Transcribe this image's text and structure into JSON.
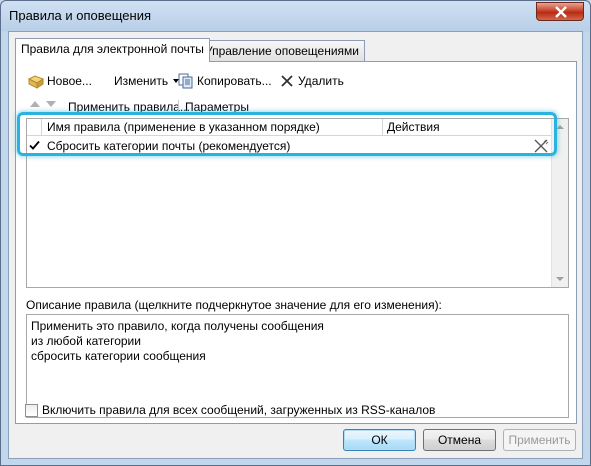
{
  "window": {
    "title": "Правила и оповещения"
  },
  "tabs": [
    {
      "label": "Правила для электронной почты"
    },
    {
      "label": "Управление оповещениями"
    }
  ],
  "toolbar": {
    "new_label": "Новое...",
    "change_label": "Изменить",
    "copy_label": "Копировать...",
    "delete_label": "Удалить"
  },
  "subbar": {
    "apply_label": "Применить правила...",
    "options_label": "Параметры"
  },
  "rules_list": {
    "columns": [
      "Имя правила (применение в указанном порядке)",
      "Действия"
    ],
    "rows": [
      {
        "name": "Сбросить категории почты (рекомендуется)",
        "checked": true
      }
    ]
  },
  "description": {
    "label": "Описание правила (щелкните подчеркнутое значение для его изменения):",
    "lines": [
      "Применить это правило, когда получены сообщения",
      "из любой категории",
      "сбросить категории сообщения"
    ]
  },
  "rss": {
    "label": "Включить правила для всех сообщений, загруженных из RSS-каналов",
    "checked": false
  },
  "buttons": {
    "ok": "ОК",
    "cancel": "Отмена",
    "apply": "Применить"
  },
  "colors": {
    "highlight": "#2bb3e0",
    "close_button": "#c8452c"
  },
  "icons": [
    "close-icon",
    "new-rule-icon",
    "copy-icon",
    "delete-icon",
    "move-up-icon",
    "move-down-icon",
    "checkmark-icon",
    "rule-action-icon"
  ]
}
